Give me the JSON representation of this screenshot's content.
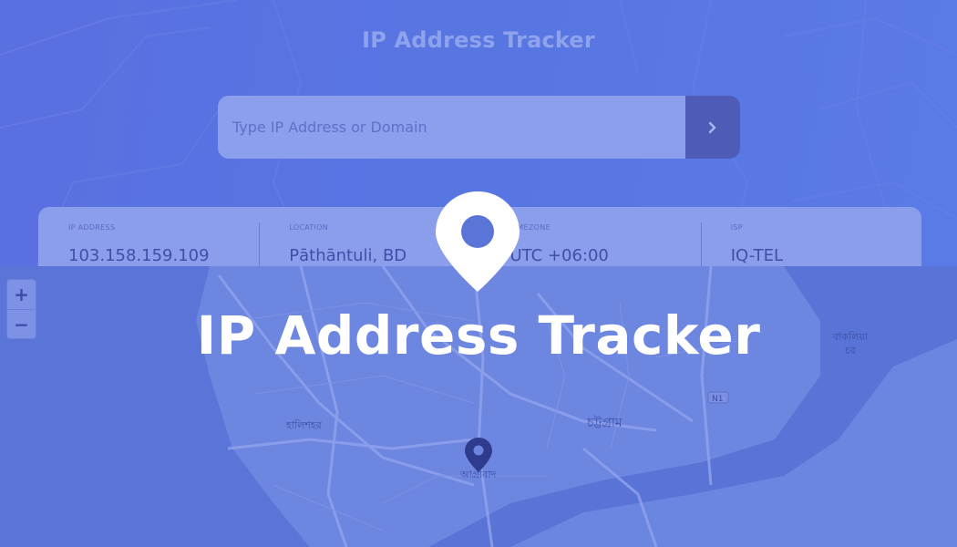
{
  "header": {
    "title": "IP Address Tracker"
  },
  "search": {
    "placeholder": "Type IP Address or Domain",
    "button_icon": "chevron-right-icon"
  },
  "info": [
    {
      "label": "IP ADDRESS",
      "value": "103.158.159.109"
    },
    {
      "label": "LOCATION",
      "value": "Pāthāntuli, BD"
    },
    {
      "label": "TIMEZONE",
      "value": "UTC +06:00"
    },
    {
      "label": "ISP",
      "value": "IQ-TEL"
    }
  ],
  "map": {
    "zoom_in": "+",
    "zoom_out": "−",
    "labels": {
      "halishahar": "হালিশহর",
      "chattogram": "চট্টগ্রাম",
      "agrabad": "আগ্রাবাদ",
      "bakalia": "বাকলিয়া\nচর",
      "road": "N1"
    }
  },
  "overlay": {
    "title": "IP Address Tracker"
  },
  "colors": {
    "accent": "#5a6fe0",
    "card": "#8b9eec",
    "marker": "#3e4fa6",
    "white": "#ffffff"
  }
}
